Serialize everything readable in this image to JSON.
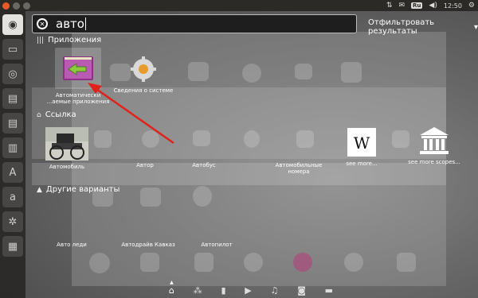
{
  "top_panel": {
    "keyboard_layout": "Ru",
    "time": "12:50"
  },
  "launcher": {
    "items": [
      "dash-home-icon",
      "terminal-icon",
      "disk-icon",
      "files-icon",
      "files-icon",
      "files-icon",
      "text-icon",
      "amazon-icon",
      "settings-icon",
      "more-icon"
    ]
  },
  "search": {
    "query": "авто",
    "filter_label": "Отфильтровать результаты",
    "filter_arrow": "▾"
  },
  "sections": {
    "applications": {
      "title": "Приложения",
      "items": [
        {
          "label": "Автоматически запускаемые приложения",
          "label_line1": "Автоматически",
          "label_line2": "...аемые приложения"
        },
        {
          "label": "Сведения о системе"
        }
      ]
    },
    "link": {
      "title": "Ссылка",
      "items": [
        {
          "label": "Автомобиль"
        },
        {
          "label": "Автор"
        },
        {
          "label": "Автобус"
        },
        {
          "label": "Автомобильные номера",
          "label_line1": "Автомобильные",
          "label_line2": "номера"
        },
        {
          "label": "see more..."
        },
        {
          "label": "see more scopes..."
        }
      ]
    },
    "other": {
      "title": "Другие варианты",
      "items": [
        {
          "label": "Авто леди"
        },
        {
          "label": "Автодрайв Кавказ"
        },
        {
          "label": "Автопилот"
        }
      ]
    }
  },
  "colors": {
    "accent_red": "#e0231a",
    "panel_bg": "#2b2a26",
    "close_button": "#e45a2b"
  }
}
